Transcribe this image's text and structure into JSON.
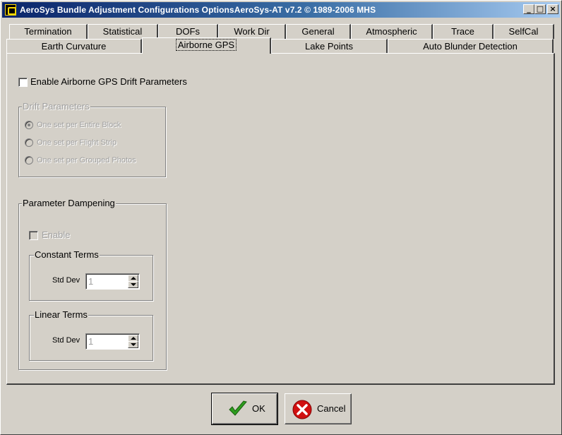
{
  "window": {
    "title": "AeroSys Bundle Adjustment Configurations OptionsAeroSys-AT  v7.2 © 1989-2006 MHS",
    "minimize_glyph": "_",
    "maximize_glyph": "□",
    "close_glyph": "×"
  },
  "tabs": {
    "row1": [
      "Termination",
      "Statistical",
      "DOFs",
      "Work Dir",
      "General",
      "Atmospheric",
      "Trace",
      "SelfCal"
    ],
    "row2": [
      "Earth Curvature",
      "Airborne GPS",
      "Lake Points",
      "Auto Blunder Detection"
    ],
    "active": "Airborne GPS"
  },
  "airborne_gps": {
    "enable_drift_label": "Enable Airborne GPS Drift  Parameters",
    "enable_drift_checked": false,
    "drift_group": {
      "title": "Drift Parameters",
      "options": [
        "One set per Entire  Block",
        "One set per Flight  Strip",
        "One set per Grouped Photos"
      ],
      "selected": "One set per Entire  Block"
    },
    "dampening_group": {
      "title": "Parameter Dampening",
      "enable_label": "Enable",
      "enable_checked": false,
      "constant_terms": {
        "title": "Constant Terms",
        "std_dev_label": "Std Dev",
        "std_dev_value": "1"
      },
      "linear_terms": {
        "title": "Linear Terms",
        "std_dev_label": "Std Dev",
        "std_dev_value": "1"
      }
    }
  },
  "buttons": {
    "ok_label": "OK",
    "cancel_label": "Cancel"
  },
  "colors": {
    "face": "#d4d0c8",
    "title_start": "#0a246a",
    "title_end": "#a6caf0",
    "ok_check": "#2e9e1e",
    "cancel_red": "#d01010"
  }
}
